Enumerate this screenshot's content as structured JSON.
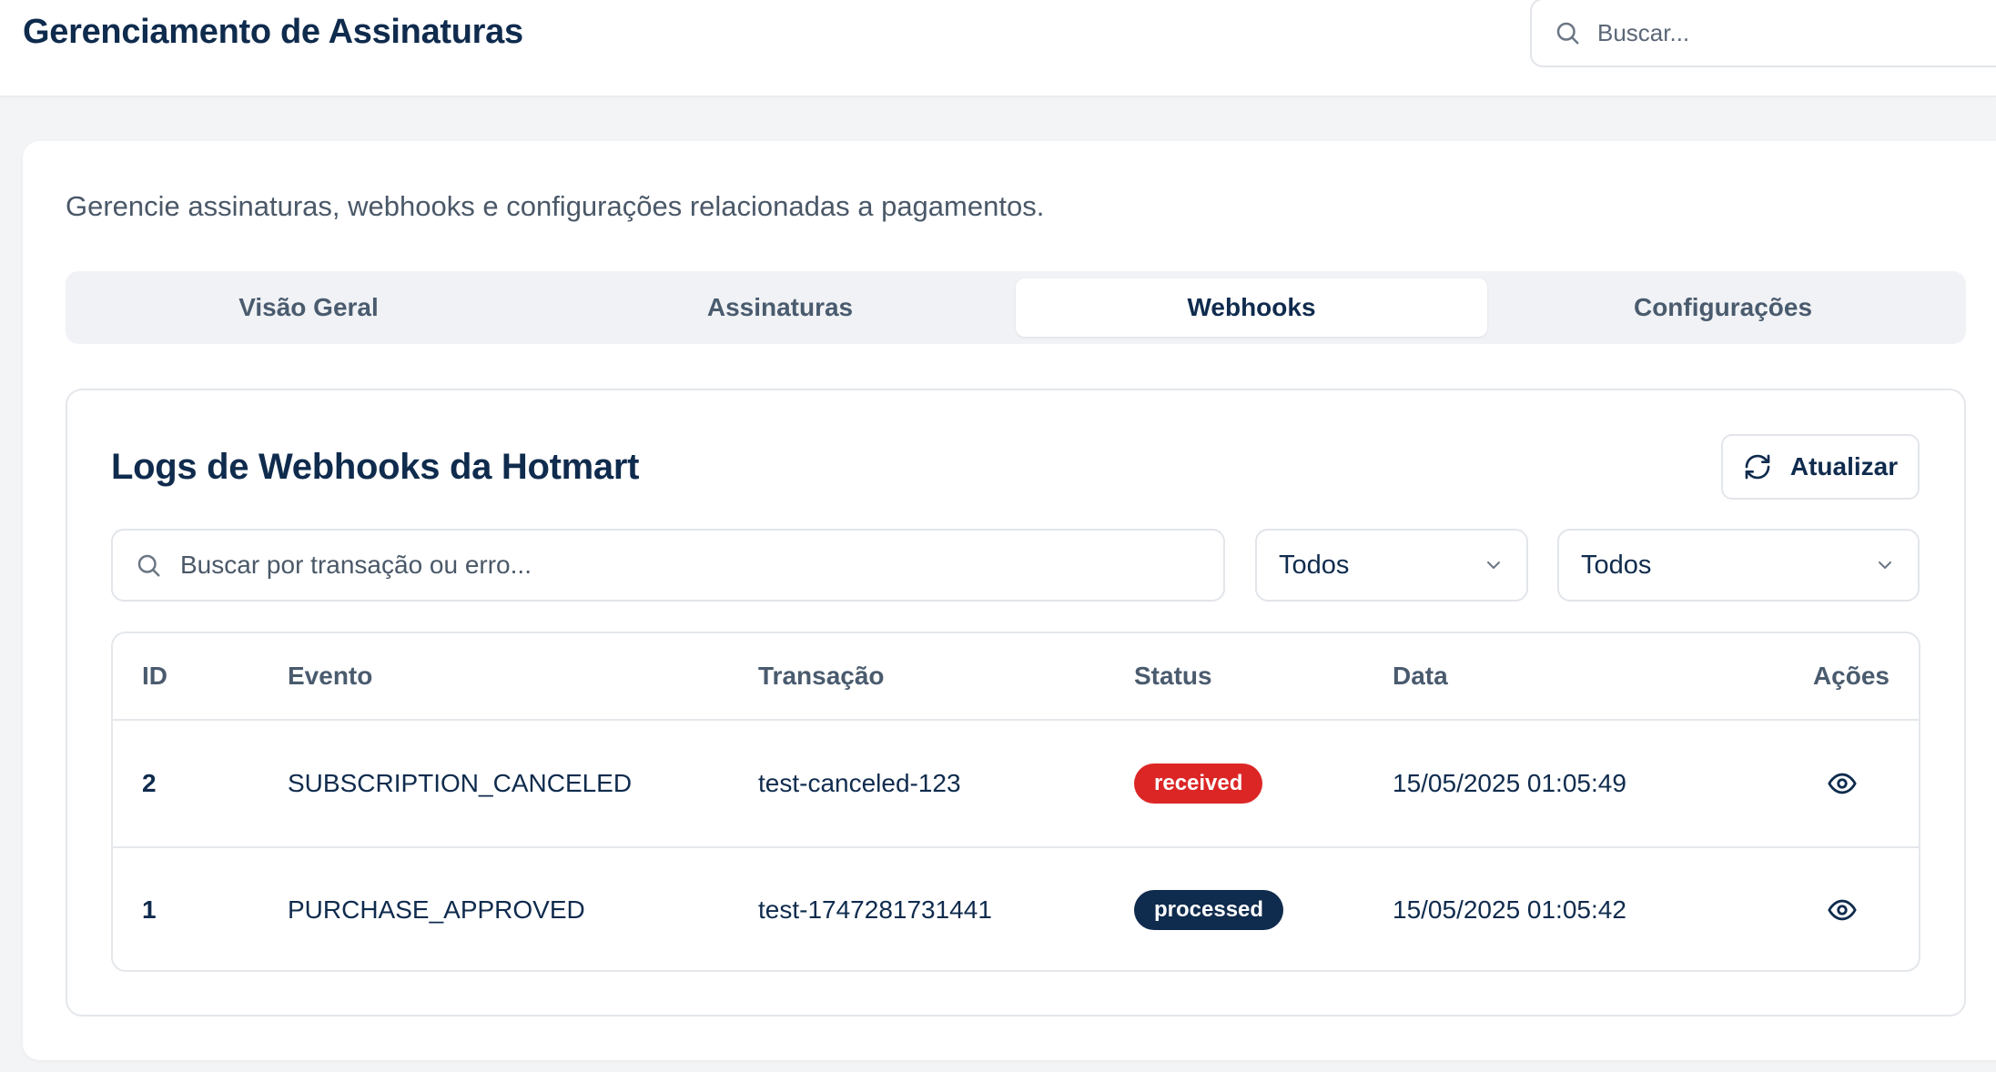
{
  "header": {
    "title": "Gerenciamento de Assinaturas",
    "search_placeholder": "Buscar..."
  },
  "page": {
    "subtitle": "Gerencie assinaturas, webhooks e configurações relacionadas a pagamentos."
  },
  "tabs": [
    {
      "label": "Visão Geral",
      "active": false
    },
    {
      "label": "Assinaturas",
      "active": false
    },
    {
      "label": "Webhooks",
      "active": true
    },
    {
      "label": "Configurações",
      "active": false
    }
  ],
  "logs": {
    "title": "Logs de Webhooks da Hotmart",
    "refresh_label": "Atualizar",
    "search_placeholder": "Buscar por transação ou erro...",
    "filter_event": "Todos",
    "filter_status": "Todos"
  },
  "table": {
    "headers": {
      "id": "ID",
      "event": "Evento",
      "transaction": "Transação",
      "status": "Status",
      "date": "Data",
      "actions": "Ações"
    },
    "rows": [
      {
        "id": "2",
        "event": "SUBSCRIPTION_CANCELED",
        "transaction": "test-canceled-123",
        "status": "received",
        "date": "15/05/2025 01:05:49"
      },
      {
        "id": "1",
        "event": "PURCHASE_APPROVED",
        "transaction": "test-1747281731441",
        "status": "processed",
        "date": "15/05/2025 01:05:42"
      }
    ]
  },
  "icons": {
    "search": "search-icon",
    "refresh": "refresh-icon",
    "dropdown": "chevron-down-icon",
    "view": "eye-icon"
  },
  "colors": {
    "primary": "#0f2b4d",
    "received": "#dc2626",
    "processed": "#0f2b4d",
    "muted_text": "#4a5868",
    "border": "#e4e7eb"
  }
}
